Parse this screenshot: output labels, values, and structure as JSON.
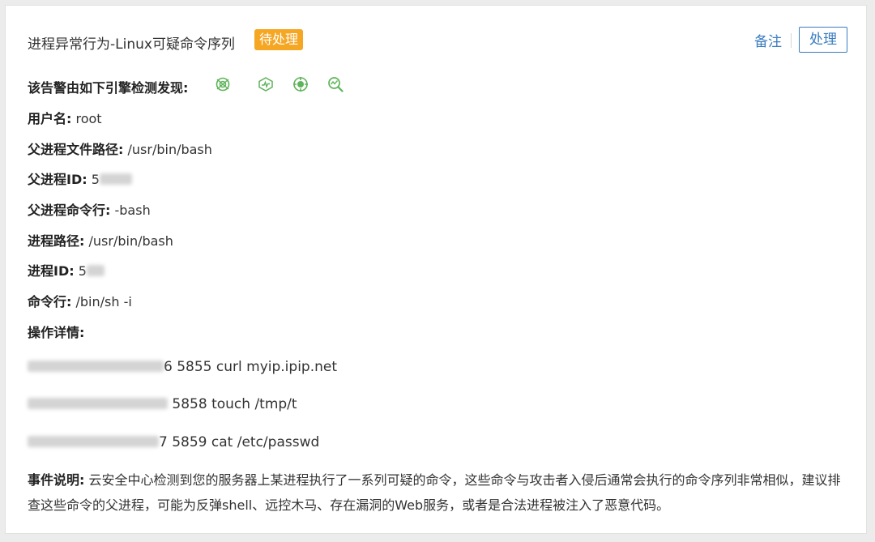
{
  "header": {
    "title": "进程异常行为-Linux可疑命令序列",
    "status": "待处理",
    "note_label": "备注",
    "handle_label": "处理"
  },
  "colors": {
    "status_badge": "#f5a623",
    "link": "#3a7cc0",
    "engine_icon": "#5fb35a"
  },
  "engines": {
    "label": "该告警由如下引擎检测发现:",
    "icons": [
      "engine-detection-icon-1",
      "engine-detection-icon-2",
      "engine-detection-icon-3",
      "engine-detection-icon-4"
    ]
  },
  "fields": {
    "username": {
      "label": "用户名:",
      "value": "root"
    },
    "parent_path": {
      "label": "父进程文件路径:",
      "value": "/usr/bin/bash"
    },
    "parent_pid": {
      "label": "父进程ID:",
      "value": "5"
    },
    "parent_cmd": {
      "label": "父进程命令行:",
      "value": "-bash"
    },
    "process_path": {
      "label": "进程路径:",
      "value": "/usr/bin/bash"
    },
    "pid": {
      "label": "进程ID:",
      "value": "5"
    },
    "cmd": {
      "label": "命令行:",
      "value": "/bin/sh -i"
    },
    "operations": {
      "label": "操作详情:"
    }
  },
  "operations": [
    {
      "prefix": "6",
      "text": "5855 curl myip.ipip.net"
    },
    {
      "prefix": "",
      "text": "5858 touch /tmp/t"
    },
    {
      "prefix": "7",
      "text": "5859 cat /etc/passwd"
    }
  ],
  "description": {
    "label": "事件说明:",
    "text": "云安全中心检测到您的服务器上某进程执行了一系列可疑的命令，这些命令与攻击者入侵后通常会执行的命令序列非常相似，建议排查这些命令的父进程，可能为反弹shell、远控木马、存在漏洞的Web服务，或者是合法进程被注入了恶意代码。"
  }
}
